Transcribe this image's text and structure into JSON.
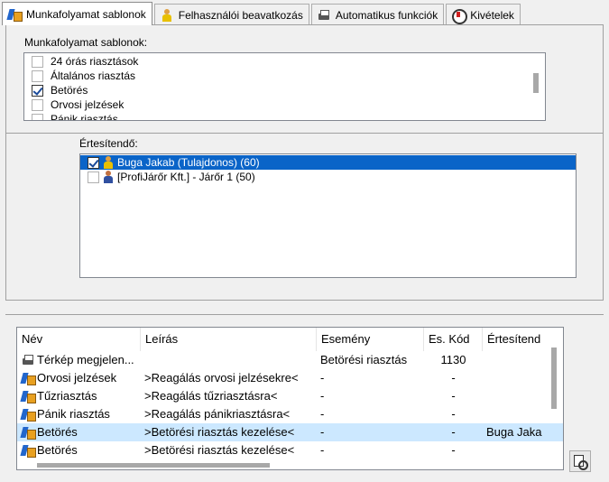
{
  "tabs": [
    {
      "label": "Munkafolyamat sablonok",
      "icon": "workflow-icon",
      "active": true
    },
    {
      "label": "Felhasználói beavatkozás",
      "icon": "user-icon",
      "active": false
    },
    {
      "label": "Automatikus funkciók",
      "icon": "printer-icon",
      "active": false
    },
    {
      "label": "Kivételek",
      "icon": "exception-icon",
      "active": false
    }
  ],
  "templates": {
    "label": "Munkafolyamat sablonok:",
    "items": [
      {
        "label": "24 órás riasztások",
        "checked": false
      },
      {
        "label": "Általános riasztás",
        "checked": false
      },
      {
        "label": "Betörés",
        "checked": true
      },
      {
        "label": "Orvosi jelzések",
        "checked": false
      },
      {
        "label": "Pánik riasztás",
        "checked": false
      }
    ]
  },
  "notify": {
    "label": "Értesítendő:",
    "items": [
      {
        "label": "Buga Jakab (Tulajdonos) (60)",
        "checked": true,
        "selected": true,
        "icon": "owner-icon"
      },
      {
        "label": "[ProfiJárőr Kft.] - Járőr 1 (50)",
        "checked": false,
        "selected": false,
        "icon": "guard-icon"
      }
    ]
  },
  "grid": {
    "headers": [
      "Név",
      "Leírás",
      "Esemény",
      "Es. Kód",
      "Értesítend"
    ],
    "rows": [
      {
        "icon": "printer-icon",
        "name": "Térkép megjelen...",
        "desc": "",
        "event": "Betörési riasztás",
        "code": "1130",
        "notify": "",
        "highlight": false
      },
      {
        "icon": "workflow-icon",
        "name": "Orvosi jelzések",
        "desc": ">Reagálás orvosi jelzésekre<",
        "event": "-",
        "code": "-",
        "notify": "",
        "highlight": false
      },
      {
        "icon": "workflow-icon",
        "name": "Tűzriasztás",
        "desc": ">Reagálás tűzriasztásra<",
        "event": "-",
        "code": "-",
        "notify": "",
        "highlight": false
      },
      {
        "icon": "workflow-icon",
        "name": "Pánik riasztás",
        "desc": ">Reagálás pánikriasztásra<",
        "event": "-",
        "code": "-",
        "notify": "",
        "highlight": false
      },
      {
        "icon": "workflow-icon",
        "name": "Betörés",
        "desc": ">Betörési riasztás kezelése<",
        "event": "-",
        "code": "-",
        "notify": "Buga Jaka",
        "highlight": true
      },
      {
        "icon": "workflow-icon",
        "name": "Betörés",
        "desc": ">Betörési riasztás kezelése<",
        "event": "-",
        "code": "-",
        "notify": "",
        "highlight": false
      }
    ]
  },
  "colors": {
    "selection": "#0a64c8",
    "row_highlight": "#cce8ff"
  }
}
